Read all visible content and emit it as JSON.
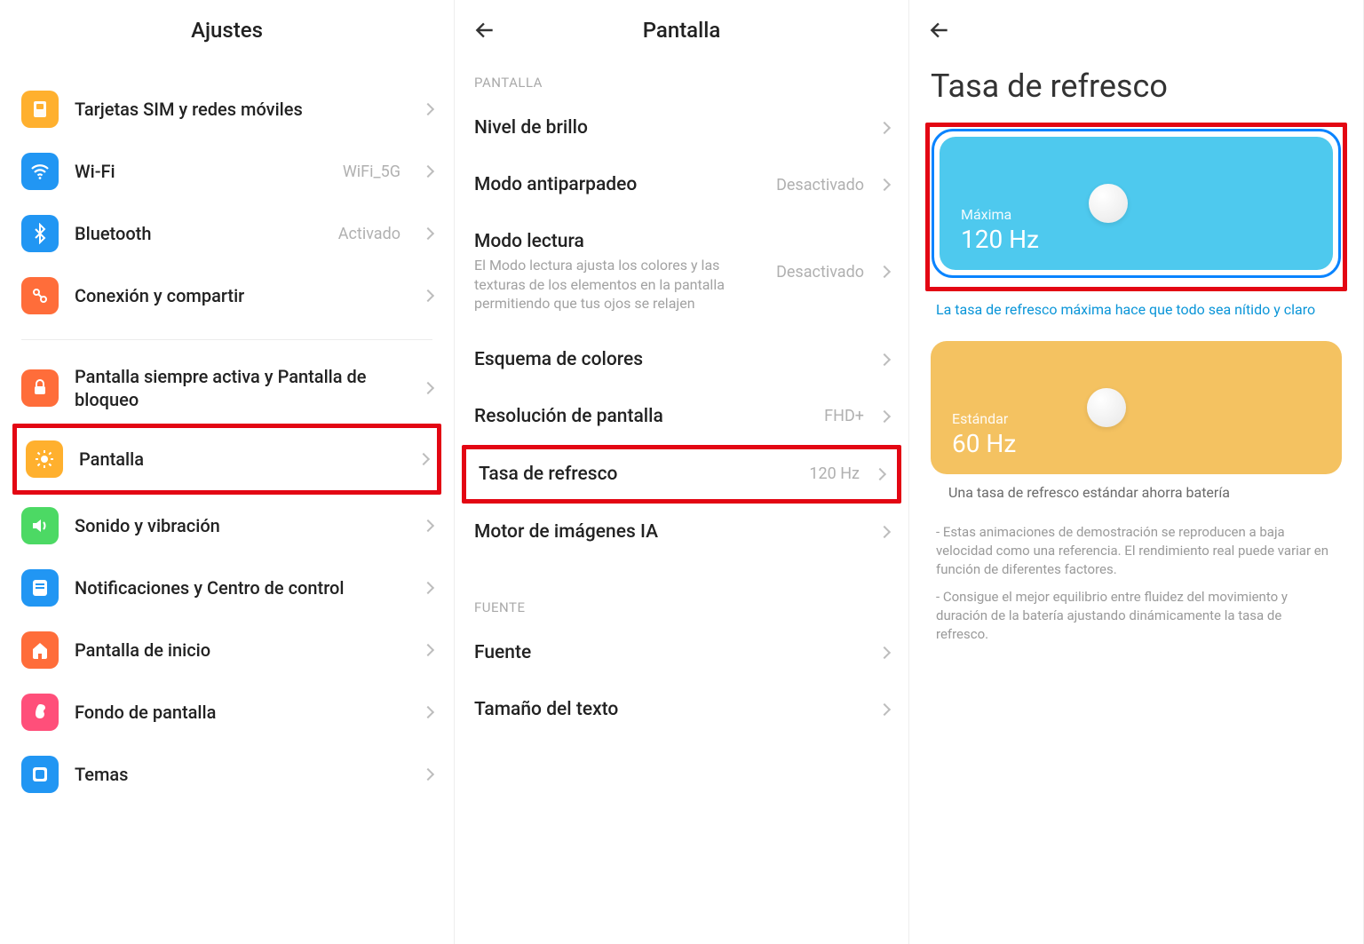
{
  "panel1": {
    "title": "Ajustes",
    "groups": [
      [
        {
          "key": "sim",
          "label": "Tarjetas SIM y redes móviles",
          "value": ""
        },
        {
          "key": "wifi",
          "label": "Wi-Fi",
          "value": "WiFi_5G"
        },
        {
          "key": "bt",
          "label": "Bluetooth",
          "value": "Activado"
        },
        {
          "key": "conn",
          "label": "Conexión y compartir",
          "value": ""
        }
      ],
      [
        {
          "key": "lock",
          "label": "Pantalla siempre activa y Pantalla de bloqueo",
          "value": ""
        },
        {
          "key": "disp",
          "label": "Pantalla",
          "value": "",
          "highlighted": true
        },
        {
          "key": "sound",
          "label": "Sonido y vibración",
          "value": ""
        },
        {
          "key": "notif",
          "label": "Notificaciones y Centro de control",
          "value": ""
        },
        {
          "key": "home",
          "label": "Pantalla de inicio",
          "value": ""
        },
        {
          "key": "wall",
          "label": "Fondo de pantalla",
          "value": ""
        },
        {
          "key": "theme",
          "label": "Temas",
          "value": ""
        }
      ]
    ]
  },
  "panel2": {
    "title": "Pantalla",
    "sections": [
      {
        "label": "PANTALLA",
        "items": [
          {
            "key": "brightness",
            "title": "Nivel de brillo",
            "desc": "",
            "value": ""
          },
          {
            "key": "antiflicker",
            "title": "Modo antiparpadeo",
            "desc": "",
            "value": "Desactivado"
          },
          {
            "key": "readmode",
            "title": "Modo lectura",
            "desc": "El Modo lectura ajusta los colores y las texturas de los elementos en la pantalla permitiendo que tus ojos se relajen",
            "value": "Desactivado"
          },
          {
            "key": "colorscheme",
            "title": "Esquema de colores",
            "desc": "",
            "value": ""
          },
          {
            "key": "resolution",
            "title": "Resolución de pantalla",
            "desc": "",
            "value": "FHD+"
          },
          {
            "key": "refresh",
            "title": "Tasa de refresco",
            "desc": "",
            "value": "120 Hz",
            "highlighted": true
          },
          {
            "key": "aiengine",
            "title": "Motor de imágenes IA",
            "desc": "",
            "value": ""
          }
        ]
      },
      {
        "label": "FUENTE",
        "items": [
          {
            "key": "font",
            "title": "Fuente",
            "desc": "",
            "value": ""
          },
          {
            "key": "textsize",
            "title": "Tamaño del texto",
            "desc": "",
            "value": ""
          }
        ]
      }
    ]
  },
  "panel3": {
    "title": "Tasa de refresco",
    "options": [
      {
        "key": "max",
        "name": "Máxima",
        "hz": "120 Hz",
        "caption": "La tasa de refresco máxima hace que todo sea nítido y claro",
        "selected": true,
        "highlighted": true
      },
      {
        "key": "std",
        "name": "Estándar",
        "hz": "60 Hz",
        "caption": "Una tasa de refresco estándar ahorra batería",
        "selected": false
      }
    ],
    "footnotes": [
      "- Estas animaciones de demostración se reproducen a baja velocidad como una referencia. El rendimiento real puede variar en función de diferentes factores.",
      "- Consigue el mejor equilibrio entre fluidez del movimiento y duración de la batería ajustando dinámicamente la tasa de refresco."
    ]
  }
}
